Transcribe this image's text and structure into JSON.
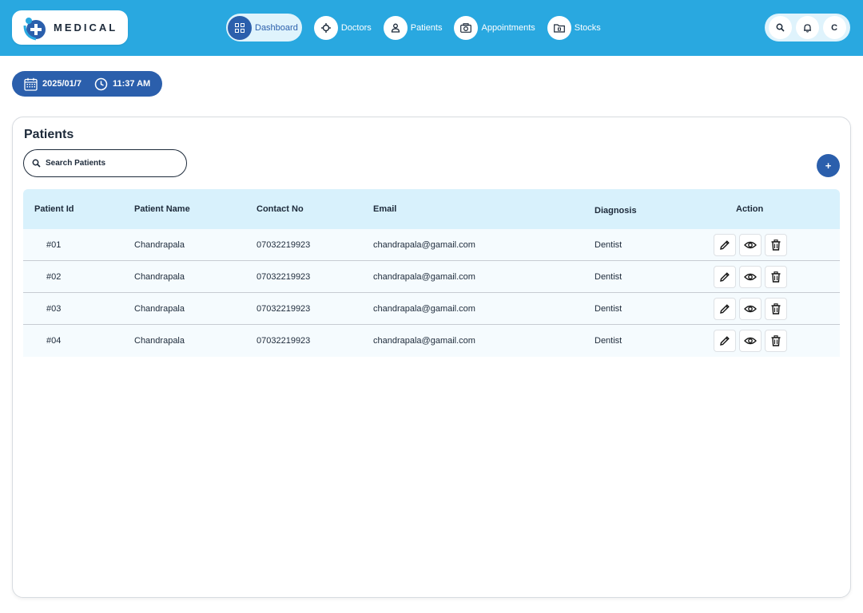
{
  "app": {
    "logo_text": "MEDICAL"
  },
  "nav": [
    {
      "label": "Dashboard",
      "icon": "grid-icon",
      "active": true
    },
    {
      "label": "Doctors",
      "icon": "crosshair-icon",
      "active": false
    },
    {
      "label": "Patients",
      "icon": "user-icon",
      "active": false
    },
    {
      "label": "Appointments",
      "icon": "camera-icon",
      "active": false
    },
    {
      "label": "Stocks",
      "icon": "folder-icon",
      "active": false
    }
  ],
  "top_actions": {
    "avatar_initial": "C"
  },
  "datetime": {
    "date": "2025/01/7",
    "time": "11:37 AM"
  },
  "patients": {
    "title": "Patients",
    "search_placeholder": "Search Patients",
    "add_label": "+",
    "columns": {
      "id": "Patient Id",
      "name": "Patient Name",
      "contact": "Contact No",
      "email": "Email",
      "diagnosis": "Diagnosis",
      "action": "Action"
    },
    "rows": [
      {
        "id": "#01",
        "name": "Chandrapala",
        "contact": "07032219923",
        "email": "chandrapala@gamail.com",
        "diagnosis": "Dentist"
      },
      {
        "id": "#02",
        "name": "Chandrapala",
        "contact": "07032219923",
        "email": "chandrapala@gamail.com",
        "diagnosis": "Dentist"
      },
      {
        "id": "#03",
        "name": "Chandrapala",
        "contact": "07032219923",
        "email": "chandrapala@gamail.com",
        "diagnosis": "Dentist"
      },
      {
        "id": "#04",
        "name": "Chandrapala",
        "contact": "07032219923",
        "email": "chandrapala@gamail.com",
        "diagnosis": "Dentist"
      }
    ]
  },
  "colors": {
    "topbar": "#29a8e0",
    "primary": "#2b5fac",
    "header_bg": "#d8f1fc"
  }
}
